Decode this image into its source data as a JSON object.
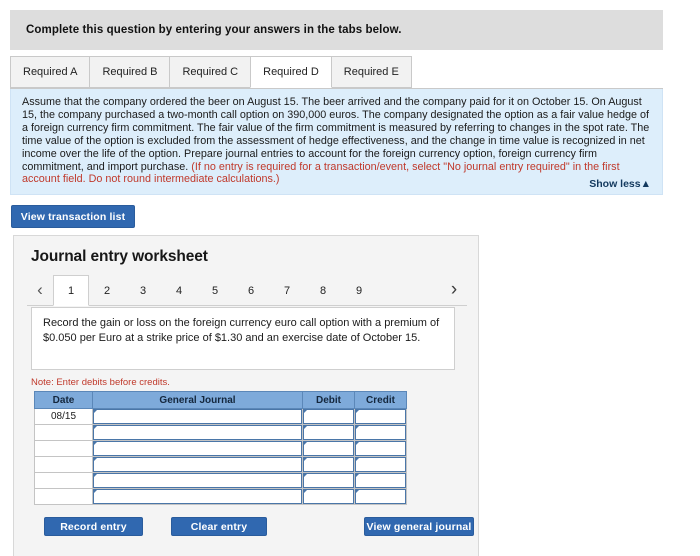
{
  "banner": {
    "text": "Complete this question by entering your answers in the tabs below."
  },
  "tabs": [
    {
      "label": "Required A",
      "active": false
    },
    {
      "label": "Required B",
      "active": false
    },
    {
      "label": "Required C",
      "active": false
    },
    {
      "label": "Required D",
      "active": true
    },
    {
      "label": "Required E",
      "active": false
    }
  ],
  "question": {
    "part1": "Assume that the company ordered the beer on August 15. The beer arrived and the company paid for it on October 15. On August 15, the company purchased a two-month call option on 390,000 euros. The company designated the option as a fair value hedge of a foreign currency firm commitment. The fair value of the firm commitment is measured by referring to changes in the spot rate. The time value of the option is excluded from the assessment of hedge effectiveness, and the change in time value is recognized in net income over the life of the option. Prepare journal entries to account for the foreign currency option, foreign currency firm commitment, and import purchase. ",
    "part2_red": "(If no entry is required for a transaction/event, select \"No journal entry required\" in the first account field. Do not round intermediate calculations.)",
    "show_less_label": "Show less▲"
  },
  "toolbar": {
    "view_transaction_list_label": "View transaction list"
  },
  "worksheet": {
    "title": "Journal entry worksheet",
    "pager": {
      "prev_icon": "‹",
      "next_icon": "›",
      "pages": [
        "1",
        "2",
        "3",
        "4",
        "5",
        "6",
        "7",
        "8",
        "9"
      ],
      "active_page": "1"
    },
    "prompt": "Record the gain or loss on the foreign currency euro call option with a premium of $0.050 per Euro at a strike price of $1.30 and an exercise date of October 15.",
    "note": "Note: Enter debits before credits.",
    "table": {
      "headers": [
        "Date",
        "General Journal",
        "Debit",
        "Credit"
      ],
      "rows": [
        {
          "date": "08/15",
          "general_journal": "",
          "debit": "",
          "credit": ""
        },
        {
          "date": "",
          "general_journal": "",
          "debit": "",
          "credit": ""
        },
        {
          "date": "",
          "general_journal": "",
          "debit": "",
          "credit": ""
        },
        {
          "date": "",
          "general_journal": "",
          "debit": "",
          "credit": ""
        },
        {
          "date": "",
          "general_journal": "",
          "debit": "",
          "credit": ""
        },
        {
          "date": "",
          "general_journal": "",
          "debit": "",
          "credit": ""
        }
      ]
    },
    "buttons": {
      "record_entry": "Record entry",
      "clear_entry": "Clear entry",
      "view_general_journal": "View general journal"
    }
  },
  "colors": {
    "accent_blue": "#3068b0",
    "info_panel": "#ddeefb",
    "table_header": "#7eaada",
    "note_red": "#c0392b",
    "banner_gray": "#dddddd"
  }
}
